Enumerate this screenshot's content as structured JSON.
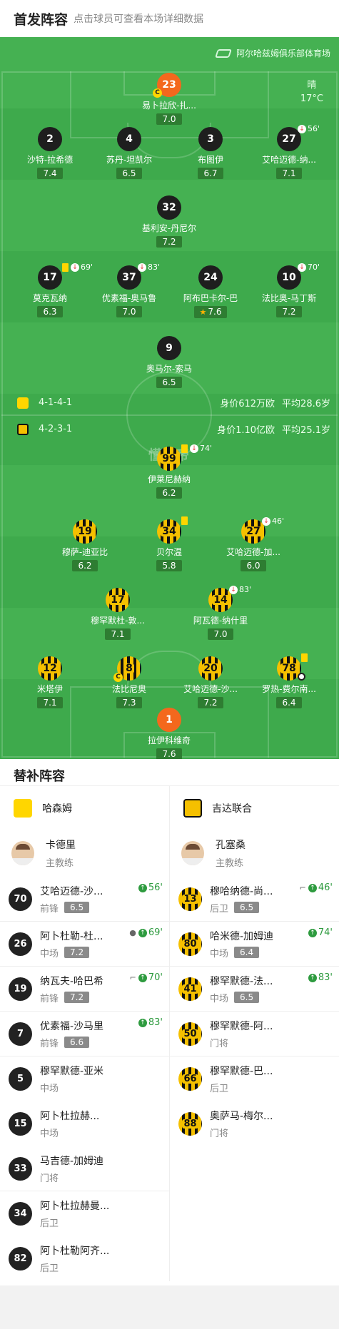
{
  "header": {
    "title": "首发阵容",
    "subtitle": "点击球员可查看本场详细数据"
  },
  "venue": "阿尔哈兹姆俱乐部体育场",
  "weather": {
    "condition": "晴",
    "temp": "17°C"
  },
  "watermark": "懂球帝",
  "home_team": {
    "formation": "4-1-4-1",
    "value": "身价612万欧",
    "age": "平均28.6岁",
    "color": "#ffd600"
  },
  "away_team": {
    "formation": "4-2-3-1",
    "value": "身价1.10亿欧",
    "age": "平均25.1岁",
    "color": "#f5c000"
  },
  "home_players": [
    {
      "num": "23",
      "name": "易卜拉欣-扎...",
      "rating": "7.0",
      "captain": "C"
    },
    {
      "num": "2",
      "name": "沙特-拉希德",
      "rating": "7.4"
    },
    {
      "num": "4",
      "name": "苏丹-坦凯尔",
      "rating": "6.5"
    },
    {
      "num": "3",
      "name": "布图伊",
      "rating": "6.7"
    },
    {
      "num": "27",
      "name": "艾哈迈德-纳...",
      "rating": "7.1",
      "sub": "56'"
    },
    {
      "num": "32",
      "name": "基利安-丹尼尔",
      "rating": "7.2"
    },
    {
      "num": "17",
      "name": "莫克瓦纳",
      "rating": "6.3",
      "sub": "69'"
    },
    {
      "num": "37",
      "name": "优素福-奥马鲁",
      "rating": "7.0",
      "sub": "83'"
    },
    {
      "num": "24",
      "name": "阿布巴卡尔-巴",
      "rating": "7.6"
    },
    {
      "num": "10",
      "name": "法比奥-马丁斯",
      "rating": "7.2",
      "sub": "70'"
    },
    {
      "num": "9",
      "name": "奥马尔-索马",
      "rating": "6.5"
    }
  ],
  "away_players": [
    {
      "num": "99",
      "name": "伊莱尼赫纳",
      "rating": "6.2",
      "sub": "74'"
    },
    {
      "num": "19",
      "name": "穆萨-迪亚比",
      "rating": "6.2"
    },
    {
      "num": "34",
      "name": "贝尔温",
      "rating": "5.8"
    },
    {
      "num": "27",
      "name": "艾哈迈德-加...",
      "rating": "6.0",
      "sub": "46'"
    },
    {
      "num": "17",
      "name": "穆罕默杜-敦...",
      "rating": "7.1"
    },
    {
      "num": "14",
      "name": "阿瓦德-纳什里",
      "rating": "7.0",
      "sub": "83'"
    },
    {
      "num": "12",
      "name": "米塔伊",
      "rating": "7.1"
    },
    {
      "num": "8",
      "name": "法比尼奥",
      "rating": "7.3",
      "captain": "C"
    },
    {
      "num": "20",
      "name": "艾哈迈德-沙...",
      "rating": "7.2"
    },
    {
      "num": "78",
      "name": "罗热-费尔南...",
      "rating": "6.4"
    },
    {
      "num": "1",
      "name": "拉伊科维奇",
      "rating": "7.6"
    }
  ],
  "subs": {
    "title": "替补阵容",
    "home": {
      "team": "哈森姆",
      "coach": {
        "name": "卡德里",
        "role": "主教练"
      },
      "players": [
        {
          "num": "70",
          "name": "艾哈迈德-沙...",
          "pos": "前锋",
          "rating": "6.5",
          "time": "56'"
        },
        {
          "num": "26",
          "name": "阿卜杜勒-杜...",
          "pos": "中场",
          "rating": "7.2",
          "time": "69'"
        },
        {
          "num": "19",
          "name": "纳瓦夫-哈巴希",
          "pos": "前锋",
          "rating": "7.2",
          "time": "70'"
        },
        {
          "num": "7",
          "name": "优素福-沙马里",
          "pos": "前锋",
          "rating": "6.6",
          "time": "83'"
        },
        {
          "num": "5",
          "name": "穆罕默德-亚米",
          "pos": "中场"
        },
        {
          "num": "15",
          "name": "阿卜杜拉赫...",
          "pos": "中场"
        },
        {
          "num": "33",
          "name": "马吉德-加姆迪",
          "pos": "门将"
        },
        {
          "num": "34",
          "name": "阿卜杜拉赫曼...",
          "pos": "后卫"
        },
        {
          "num": "82",
          "name": "阿卜杜勒阿齐...",
          "pos": "后卫"
        }
      ]
    },
    "away": {
      "team": "吉达联合",
      "coach": {
        "name": "孔塞桑",
        "role": "主教练"
      },
      "players": [
        {
          "num": "13",
          "name": "穆哈纳德-尚...",
          "pos": "后卫",
          "rating": "6.5",
          "time": "46'"
        },
        {
          "num": "80",
          "name": "哈米德-加姆迪",
          "pos": "中场",
          "rating": "6.4",
          "time": "74'"
        },
        {
          "num": "41",
          "name": "穆罕默德-法...",
          "pos": "中场",
          "rating": "6.5",
          "time": "83'"
        },
        {
          "num": "50",
          "name": "穆罕默德-阿...",
          "pos": "门将"
        },
        {
          "num": "66",
          "name": "穆罕默德-巴...",
          "pos": "后卫"
        },
        {
          "num": "88",
          "name": "奥萨马-梅尔...",
          "pos": "门将"
        }
      ]
    }
  }
}
